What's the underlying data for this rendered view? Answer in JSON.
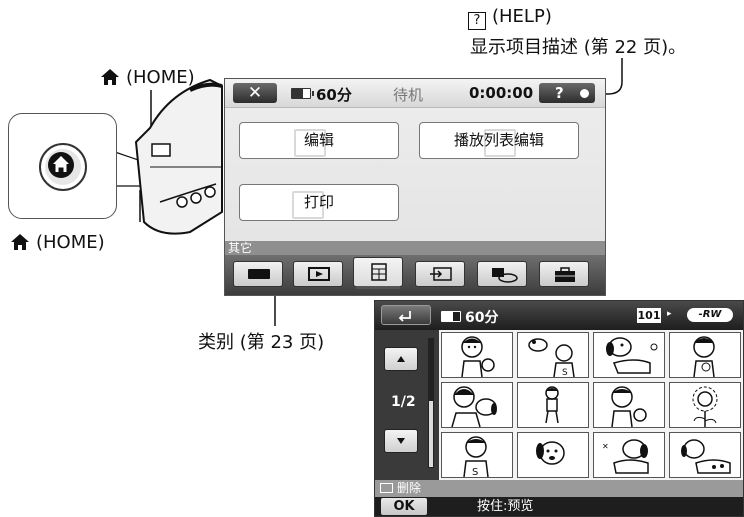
{
  "annotations": {
    "help_box_glyph": "?",
    "help_label": "(HELP)",
    "help_desc": "显示项目描述 (第 22 页)。",
    "home_label_top": "(HOME)",
    "home_label_bottom": "(HOME)",
    "category_label": "类别 (第 23 页)"
  },
  "home_menu": {
    "status": {
      "close_glyph": "✕",
      "battery_time": "60分",
      "state": "待机",
      "counter": "0:00:00",
      "help_glyph": "?"
    },
    "items": {
      "edit": "编辑",
      "playlist_edit": "播放列表编辑",
      "print": "打印"
    },
    "category_name": "其它",
    "tabs": [
      "camera-tab-icon",
      "playback-tab-icon",
      "other-tab-icon",
      "image-manage-tab-icon",
      "edit-tab-icon",
      "settings-tab-icon"
    ]
  },
  "playback": {
    "battery_time": "60分",
    "folder_no": "101",
    "folder_arrow": "▸",
    "disc_type": "-RW",
    "page": "1/2",
    "info": "删除",
    "ok": "OK",
    "hint": "按住:预览",
    "thumbnails": [
      "boy-with-dog",
      "flying-dog-and-kid",
      "dog-with-flowers",
      "girl-with-bag",
      "girl-hugging-dog",
      "small-kid",
      "boy-and-cat",
      "sunflower",
      "boy-waving",
      "dog-face",
      "sniffing-dog",
      "lying-dog"
    ]
  },
  "colors": {
    "accent_dark": "#2c2c2c",
    "screen_bg": "#e6e6e6",
    "category_bar": "#8f8f8f"
  }
}
